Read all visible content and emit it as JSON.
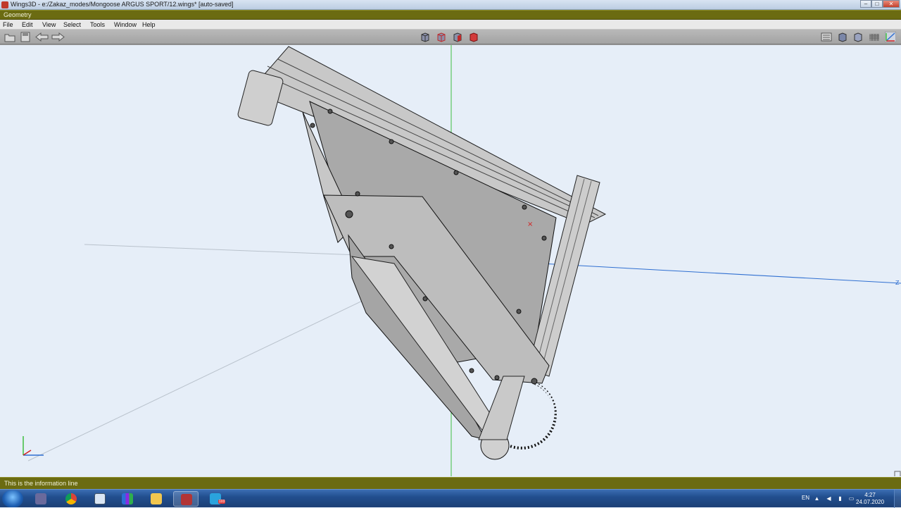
{
  "window": {
    "title": "Wings3D - e:/Zakaz_modes/Mongoose ARGUS SPORT/12.wings* [auto-saved]",
    "controls": {
      "minimize": "–",
      "maximize": "□",
      "close": "✕"
    }
  },
  "geometry_bar": {
    "label": "Geometry"
  },
  "menu": {
    "items": [
      "File",
      "Edit",
      "View",
      "Select",
      "Tools",
      "Window",
      "Help"
    ]
  },
  "toolbar": {
    "left_icons": [
      "open-icon",
      "save-icon",
      "undo-arrow-icon",
      "redo-arrow-icon"
    ],
    "selection_modes": [
      "vertex-mode-icon",
      "edge-mode-icon",
      "face-mode-icon",
      "body-mode-icon"
    ],
    "right_icons": [
      "outliner-icon",
      "smooth-shade-icon",
      "wireframe-icon",
      "grid-icon",
      "axes-icon"
    ]
  },
  "viewport": {
    "axis_label": "Z",
    "colors": {
      "background": "#e6eef8",
      "z_axis": "#2f6fd1",
      "y_axis": "#3fbf3f",
      "x_marker": "#d42020"
    }
  },
  "info_line": {
    "text": "This is the information line"
  },
  "taskbar": {
    "apps": [
      "chrome",
      "calculator",
      "winrar",
      "explorer",
      "wings3d",
      "telegram"
    ],
    "telegram_badge": "103",
    "language": "EN",
    "clock": {
      "time": "4:27",
      "date": "24.07.2020"
    }
  }
}
